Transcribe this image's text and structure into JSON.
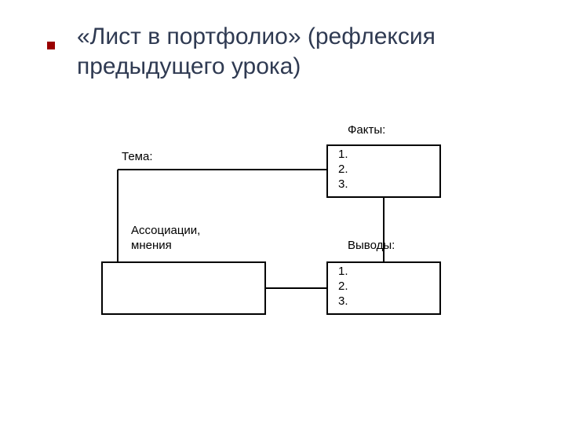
{
  "title": "«Лист в портфолио» (рефлексия предыдущего урока)",
  "labels": {
    "tema": "Тема:",
    "fakty": "Факты:",
    "assoc_l1": "Ассоциации,",
    "assoc_l2": "мнения",
    "vyvody": "Выводы:"
  },
  "box_facts": {
    "l1": "1.",
    "l2": "2.",
    "l3": "3."
  },
  "box_conclusions": {
    "l1": "1.",
    "l2": "2.",
    "l3": "3."
  }
}
